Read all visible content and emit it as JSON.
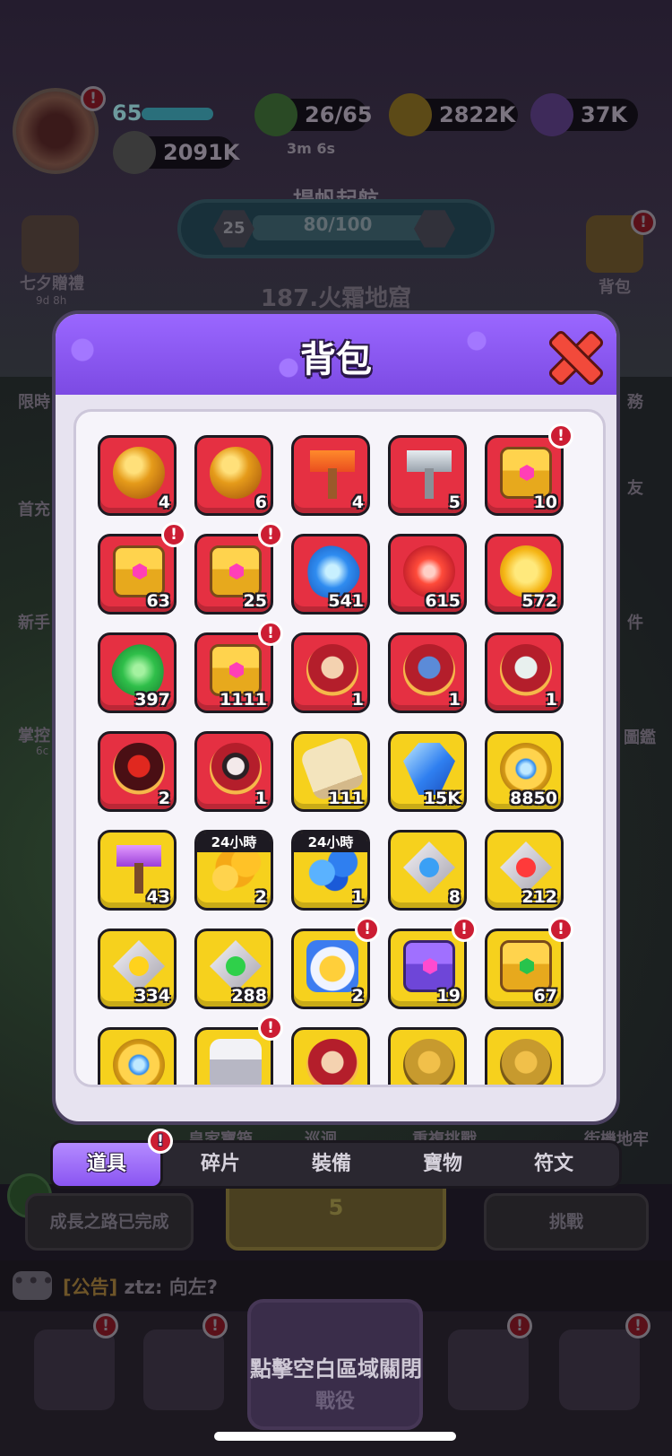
{
  "status_bar": {
    "level": "65",
    "stamina": "26/65",
    "stamina_timer": "3m 6s",
    "gold": "2822K",
    "gems": "37K",
    "power": "2091K"
  },
  "quest": {
    "title": "揚帆起航",
    "level": "25",
    "progress_text": "80/100",
    "progress_fraction": 0.8
  },
  "stage_title": "187.火霜地窟",
  "side_left": [
    {
      "label": "七夕贈禮",
      "sub": "9d 8h"
    },
    {
      "label": "限時",
      "sub": ""
    },
    {
      "label": "首充",
      "sub": ""
    },
    {
      "label": "新手",
      "sub": ""
    },
    {
      "label": "掌控",
      "sub": "6c"
    }
  ],
  "side_right": [
    {
      "label": "背包"
    },
    {
      "label": "務"
    },
    {
      "label": "友"
    },
    {
      "label": "件"
    },
    {
      "label": "圖鑑"
    },
    {
      "label": "街機地牢"
    }
  ],
  "background_buttons": {
    "growth_done": "成長之路已完成",
    "challenge": "挑戰",
    "yellow_count": "5",
    "under_panel": [
      "皇家寶箱",
      "巡迴",
      "重複挑戰"
    ]
  },
  "chat": {
    "bubble": "•••",
    "tag": "[公告]",
    "user": "ztz:",
    "message": "向左?"
  },
  "bottom_nav": {
    "battle_label": "戰役",
    "close_hint": "點擊空白區域關閉"
  },
  "panel": {
    "title": "背包",
    "items": [
      {
        "color": "red",
        "icon": "medal-icon",
        "count": "4",
        "badge": false
      },
      {
        "color": "red",
        "icon": "medal-icon",
        "count": "6",
        "badge": false
      },
      {
        "color": "red",
        "icon": "hammer-icon",
        "count": "4",
        "badge": false
      },
      {
        "color": "red",
        "icon": "silver-hammer-icon",
        "count": "5",
        "badge": false
      },
      {
        "color": "red",
        "icon": "pink-chest-icon",
        "count": "10",
        "badge": true
      },
      {
        "color": "red",
        "icon": "pink-chest-icon",
        "count": "63",
        "badge": true
      },
      {
        "color": "red",
        "icon": "pink-chest-icon",
        "count": "25",
        "badge": true
      },
      {
        "color": "red",
        "icon": "blue-gem-icon",
        "count": "541",
        "badge": false
      },
      {
        "color": "red",
        "icon": "fire-icon",
        "count": "615",
        "badge": false
      },
      {
        "color": "red",
        "icon": "bolt-icon",
        "count": "572",
        "badge": false
      },
      {
        "color": "red",
        "icon": "leaf-icon",
        "count": "397",
        "badge": false
      },
      {
        "color": "red",
        "icon": "pink-chest-icon",
        "count": "1111",
        "badge": true
      },
      {
        "color": "red",
        "icon": "hero-portrait-icon",
        "count": "1",
        "badge": false
      },
      {
        "color": "red",
        "icon": "blue-hero-portrait-icon",
        "count": "1",
        "badge": false
      },
      {
        "color": "red",
        "icon": "robot-hero-portrait-icon",
        "count": "1",
        "badge": false
      },
      {
        "color": "red",
        "icon": "dark-hero-portrait-icon",
        "count": "2",
        "badge": false
      },
      {
        "color": "red",
        "icon": "pale-hero-portrait-icon",
        "count": "1",
        "badge": false
      },
      {
        "color": "yellow",
        "icon": "scroll-icon",
        "count": "111",
        "badge": false
      },
      {
        "color": "yellow",
        "icon": "crystal-icon",
        "count": "15K",
        "badge": false
      },
      {
        "color": "yellow",
        "icon": "compass-coin-icon",
        "count": "8850",
        "badge": false
      },
      {
        "color": "yellow",
        "icon": "purple-hammer-icon",
        "count": "43",
        "badge": false
      },
      {
        "color": "yellow",
        "icon": "gold-coins-icon",
        "count": "2",
        "badge": false,
        "time": "24小時"
      },
      {
        "color": "yellow",
        "icon": "blue-orbs-icon",
        "count": "1",
        "badge": false,
        "time": "24小時"
      },
      {
        "color": "yellow",
        "icon": "blue-diamond-icon",
        "count": "8",
        "badge": false
      },
      {
        "color": "yellow",
        "icon": "red-diamond-icon",
        "count": "212",
        "badge": false
      },
      {
        "color": "yellow",
        "icon": "yellow-diamond-icon",
        "count": "334",
        "badge": false
      },
      {
        "color": "yellow",
        "icon": "green-diamond-icon",
        "count": "288",
        "badge": false
      },
      {
        "color": "yellow",
        "icon": "knight-icon",
        "count": "2",
        "badge": true
      },
      {
        "color": "yellow",
        "icon": "purple-chest-icon",
        "count": "19",
        "badge": true
      },
      {
        "color": "yellow",
        "icon": "green-chest-icon",
        "count": "67",
        "badge": true
      },
      {
        "color": "yellow",
        "icon": "compass-coin-icon",
        "count": "",
        "badge": false
      },
      {
        "color": "yellow",
        "icon": "bag-icon",
        "count": "",
        "badge": true
      },
      {
        "color": "yellow",
        "icon": "hero-portrait-icon",
        "count": "",
        "badge": false
      },
      {
        "color": "yellow",
        "icon": "gold-hero-portrait-icon",
        "count": "",
        "badge": false
      },
      {
        "color": "yellow",
        "icon": "gold-hero-portrait-icon",
        "count": "",
        "badge": false
      }
    ]
  },
  "tabs": [
    {
      "label": "道具",
      "active": true,
      "badge": true
    },
    {
      "label": "碎片",
      "active": false,
      "badge": false
    },
    {
      "label": "裝備",
      "active": false,
      "badge": false
    },
    {
      "label": "寶物",
      "active": false,
      "badge": false
    },
    {
      "label": "符文",
      "active": false,
      "badge": false
    }
  ],
  "badge_mark": "!"
}
